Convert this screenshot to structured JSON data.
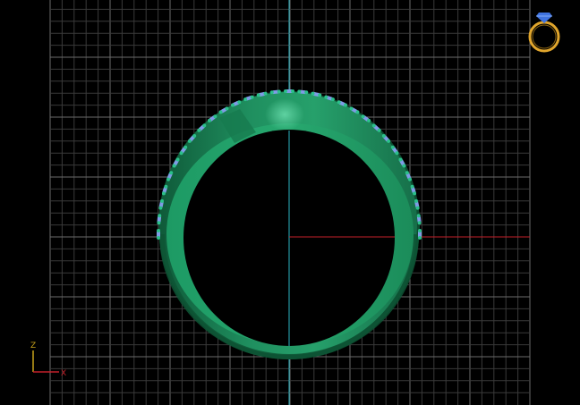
{
  "viewport": {
    "view": "front",
    "background_color": "#000000",
    "grid": {
      "visible": true,
      "minor_color": "#3a3a3a",
      "major_color": "#6c6c6c"
    },
    "axes": {
      "vertical_color": "#2bb3c2",
      "horizontal_color": "#c4202a"
    }
  },
  "model": {
    "name": "ring",
    "band_color": "#1f8f5f",
    "inner_color": "#2aa56e",
    "prong_color": "#2bc08a",
    "stone_color": "#7f9be6"
  },
  "gizmo": {
    "icon": "ring-diamond-icon",
    "diamond_color": "#3f73e0",
    "ring_color": "#e0a52c"
  },
  "axis_indicator": {
    "vertical_label": "Z",
    "horizontal_label": "X",
    "vertical_color": "#c7a21a",
    "horizontal_color": "#c4202a"
  }
}
